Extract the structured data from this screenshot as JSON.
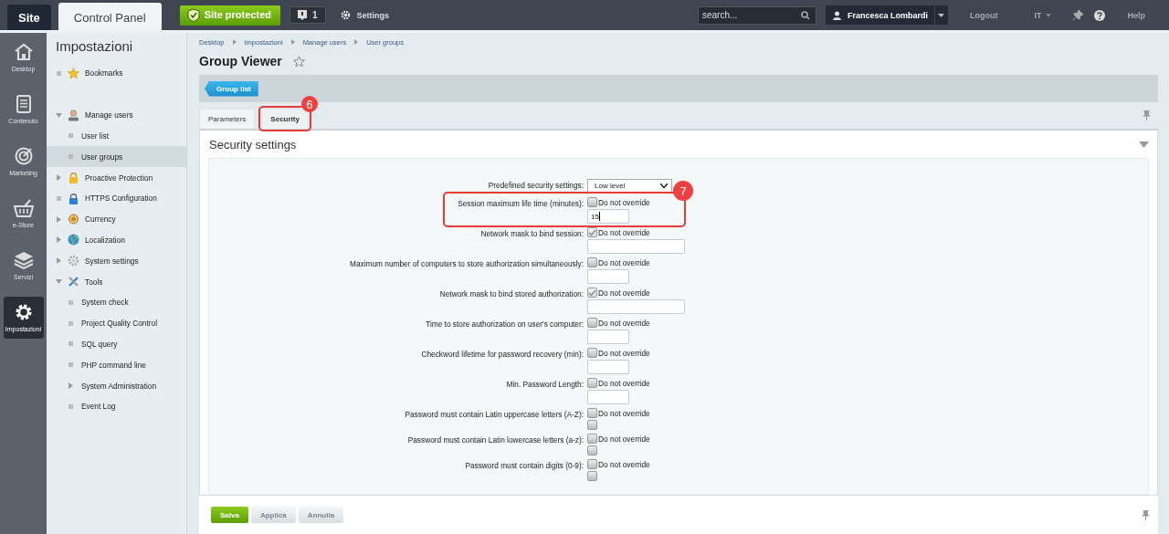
{
  "topbar": {
    "tabs": [
      {
        "label": "Site",
        "selected": false
      },
      {
        "label": "Control Panel",
        "selected": true
      }
    ],
    "protected_badge": "Site protected",
    "notifications": "1",
    "settings": "Settings",
    "search": {
      "placeholder": "search..."
    },
    "user": "Francesca Lombardi",
    "logout": "Logout",
    "language": "IT",
    "help": "Help"
  },
  "rail": [
    {
      "label": "Desktop",
      "selected": false
    },
    {
      "label": "Contenuto",
      "selected": false
    },
    {
      "label": "Marketing",
      "selected": false
    },
    {
      "label": "e-Store",
      "selected": false
    },
    {
      "label": "Servizi",
      "selected": false
    },
    {
      "label": "Impostazioni",
      "selected": true
    }
  ],
  "sidebar": {
    "title": "Impostazioni",
    "items": [
      {
        "label": "Bookmarks",
        "selected": false
      },
      {
        "label": "Manage users",
        "expanded": true,
        "selected": false,
        "children": [
          {
            "label": "User list",
            "selected": false
          },
          {
            "label": "User groups",
            "selected": true
          }
        ]
      },
      {
        "label": "Proactive Protection",
        "expanded": false,
        "selected": false
      },
      {
        "label": "HTTPS Configuration",
        "selected": false
      },
      {
        "label": "Currency",
        "expanded": false,
        "selected": false
      },
      {
        "label": "Localization",
        "expanded": false,
        "selected": false
      },
      {
        "label": "System settings",
        "expanded": false,
        "selected": false
      },
      {
        "label": "Tools",
        "expanded": true,
        "selected": false,
        "children": [
          {
            "label": "System check",
            "selected": false
          },
          {
            "label": "Project Quality Control",
            "selected": false
          },
          {
            "label": "SQL query",
            "selected": false
          },
          {
            "label": "PHP command line",
            "selected": false
          },
          {
            "label": "System Administration",
            "selected": false,
            "expanded": false
          },
          {
            "label": "Event Log",
            "selected": false
          }
        ]
      }
    ]
  },
  "breadcrumbs": [
    "Desktop",
    "Impostazioni",
    "Manage users",
    "User groups"
  ],
  "page_title": "Group Viewer",
  "back_button": "Group list",
  "tabs": [
    {
      "label": "Parameters",
      "selected": false
    },
    {
      "label": "Security",
      "selected": true,
      "callout": "6"
    }
  ],
  "section_title": "Security settings",
  "form": [
    {
      "kind": "select",
      "label": "Predefined security settings:",
      "value": "Low level"
    },
    {
      "kind": "number",
      "label": "Session maximum life time (minutes):",
      "override": "Do not override",
      "checked": false,
      "value": "15",
      "callout": "7"
    },
    {
      "kind": "mask",
      "label": "Network mask to bind session:",
      "override": "Do not override",
      "checked": true
    },
    {
      "kind": "number",
      "label": "Maximum number of computers to store authorization simultaneously:",
      "override": "Do not override",
      "checked": false
    },
    {
      "kind": "mask",
      "label": "Network mask to bind stored authorization:",
      "override": "Do not override",
      "checked": true
    },
    {
      "kind": "number",
      "label": "Time to store authorization on user's computer:",
      "override": "Do not override",
      "checked": false
    },
    {
      "kind": "number",
      "label": "Checkword lifetime for password recovery (min):",
      "override": "Do not override",
      "checked": false
    },
    {
      "kind": "number",
      "label": "Min. Password Length:",
      "override": "Do not override",
      "checked": false
    },
    {
      "kind": "flag",
      "label": "Password must contain Latin uppercase letters (A-Z):",
      "override": "Do not override",
      "checked": false,
      "value_checked": false
    },
    {
      "kind": "flag",
      "label": "Password must contain Latin lowercase letters (a-z):",
      "override": "Do not override",
      "checked": false,
      "value_checked": false
    },
    {
      "kind": "flag",
      "label": "Password must contain digits (0-9):",
      "override": "Do not override",
      "checked": false,
      "value_checked": false
    }
  ],
  "footer_buttons": [
    {
      "label": "Salva",
      "kind": "primary",
      "disabled": false
    },
    {
      "label": "Applica",
      "kind": "secondary",
      "disabled": true
    },
    {
      "label": "Annulla",
      "kind": "secondary",
      "disabled": true
    }
  ]
}
